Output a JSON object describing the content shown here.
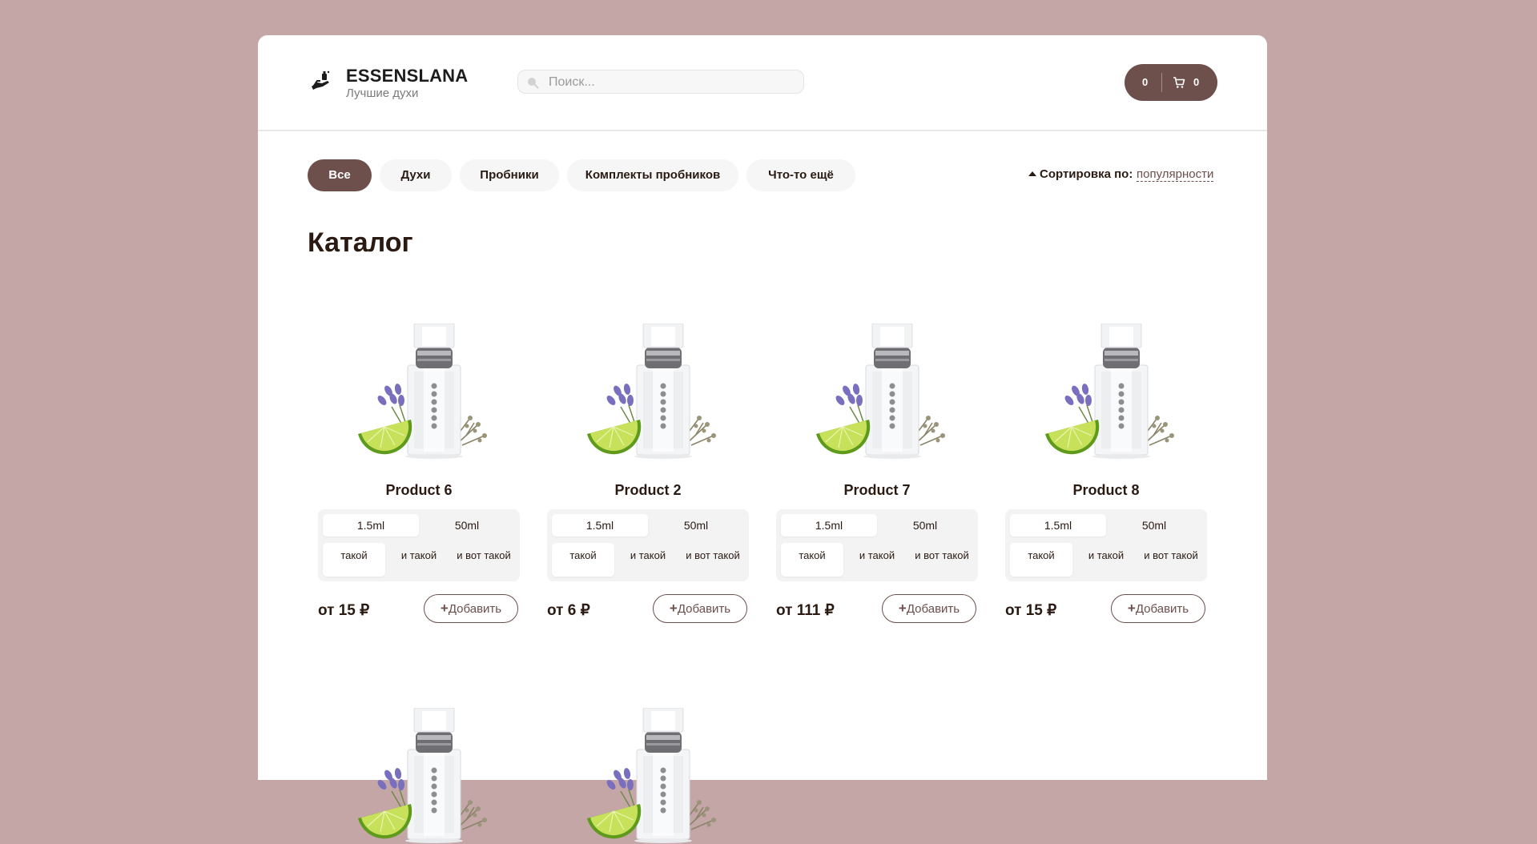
{
  "header": {
    "brand": "ESSENSLANA",
    "tagline": "Лучшие духи",
    "search_placeholder": "Поиск...",
    "cart_total": "0",
    "cart_count": "0"
  },
  "categories": [
    "Все",
    "Духи",
    "Пробники",
    "Комплекты пробников",
    "Что-то ещё"
  ],
  "active_category": "Все",
  "sort": {
    "label": "Сортировка по:",
    "value": "популярности"
  },
  "catalog_title": "Каталог",
  "products": [
    {
      "name": "Product 6",
      "sizes": [
        "1.5ml",
        "50ml"
      ],
      "types": [
        "такой",
        "и такой",
        "и вот такой"
      ],
      "price": "от 15 ₽",
      "add_label": "Добавить"
    },
    {
      "name": "Product 2",
      "sizes": [
        "1.5ml",
        "50ml"
      ],
      "types": [
        "такой",
        "и такой",
        "и вот такой"
      ],
      "price": "от 6 ₽",
      "add_label": "Добавить"
    },
    {
      "name": "Product 7",
      "sizes": [
        "1.5ml",
        "50ml"
      ],
      "types": [
        "такой",
        "и такой",
        "и вот такой"
      ],
      "price": "от 111 ₽",
      "add_label": "Добавить"
    },
    {
      "name": "Product 8",
      "sizes": [
        "1.5ml",
        "50ml"
      ],
      "types": [
        "такой",
        "и такой",
        "и вот такой"
      ],
      "price": "от 15 ₽",
      "add_label": "Добавить"
    }
  ],
  "colors": {
    "background": "#c4a6a6",
    "accent": "#6d4f4c",
    "text": "#2a1a12"
  },
  "icons": {
    "logo": "perfume-hand-icon",
    "search": "search-icon",
    "cart": "cart-icon"
  }
}
